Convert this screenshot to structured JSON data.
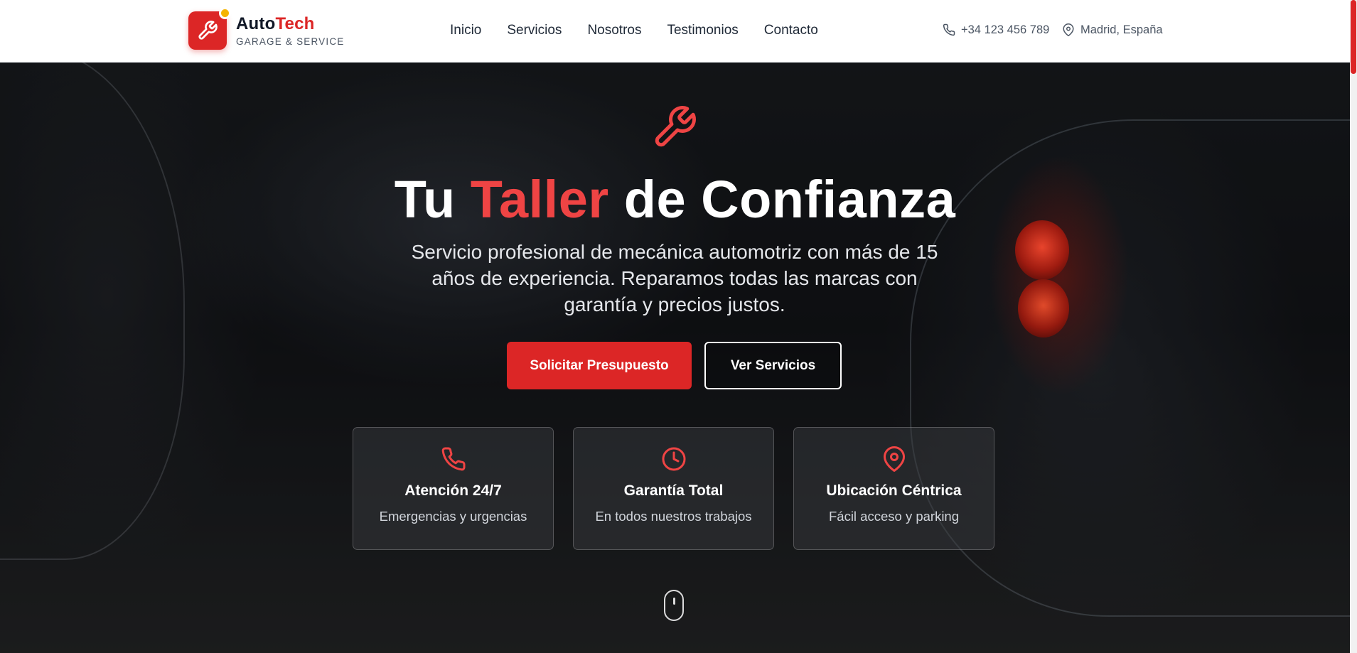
{
  "brand": {
    "name_part1": "Auto",
    "name_part2": "Tech",
    "tagline": "GARAGE & SERVICE"
  },
  "nav": {
    "items": [
      {
        "label": "Inicio"
      },
      {
        "label": "Servicios"
      },
      {
        "label": "Nosotros"
      },
      {
        "label": "Testimonios"
      },
      {
        "label": "Contacto"
      }
    ]
  },
  "header_contact": {
    "phone": "+34 123 456 789",
    "location": "Madrid, España"
  },
  "hero": {
    "title_part1": "Tu",
    "title_highlight": "Taller",
    "title_part2": "de Confianza",
    "subtitle": "Servicio profesional de mecánica automotriz con más de 15 años de experiencia. Reparamos todas las marcas con garantía y precios justos.",
    "primary_button": "Solicitar Presupuesto",
    "secondary_button": "Ver Servicios"
  },
  "features": [
    {
      "icon": "phone-icon",
      "title": "Atención 24/7",
      "text": "Emergencias y urgencias"
    },
    {
      "icon": "clock-icon",
      "title": "Garantía Total",
      "text": "En todos nuestros trabajos"
    },
    {
      "icon": "map-pin-icon",
      "title": "Ubicación Céntrica",
      "text": "Fácil acceso y parking"
    }
  ],
  "colors": {
    "accent": "#dc2626",
    "accent_light": "#ef4444",
    "badge": "#f5b400",
    "header_bg": "#ffffff",
    "text_dark": "#111827"
  }
}
